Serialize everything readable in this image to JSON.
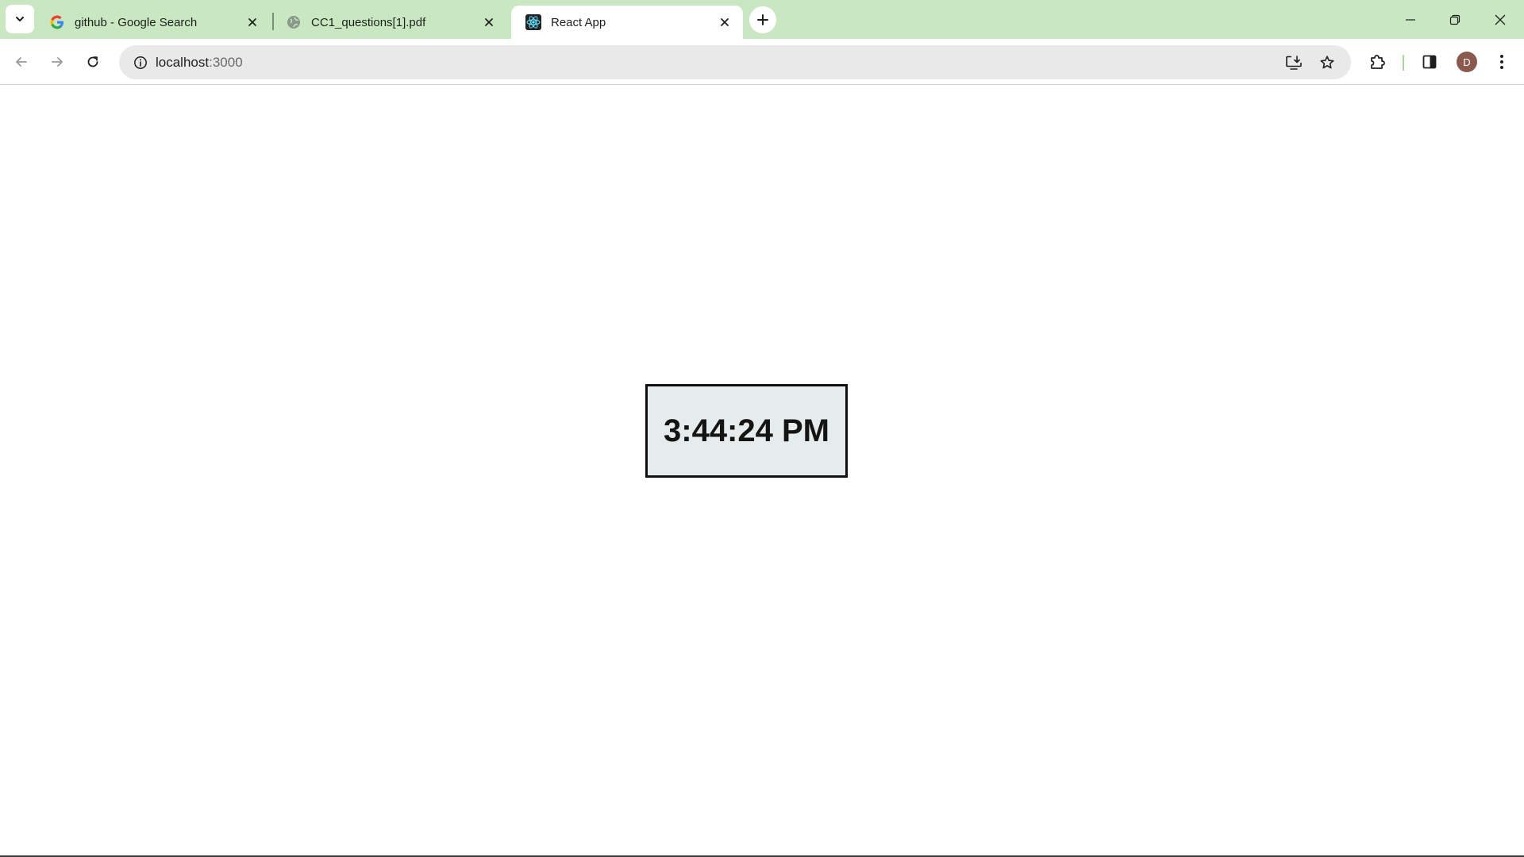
{
  "window": {
    "frame_color": "#c9e8c1",
    "controls": {
      "minimize_icon": "minimize-icon",
      "restore_icon": "restore-icon",
      "close_icon": "close-icon"
    }
  },
  "tabs": [
    {
      "title": "github - Google Search",
      "favicon": "google-g-icon",
      "active": false
    },
    {
      "title": "CC1_questions[1].pdf",
      "favicon": "globe-icon",
      "active": false
    },
    {
      "title": "React App",
      "favicon": "react-atom-icon",
      "active": true
    }
  ],
  "toolbar": {
    "url_host": "localhost",
    "url_port": ":3000",
    "avatar_letter": "D",
    "avatar_color": "#8a5a4e"
  },
  "page": {
    "clock_time": "3:44:24 PM",
    "clock_background": "#e6ecec",
    "clock_border": "#111111"
  }
}
